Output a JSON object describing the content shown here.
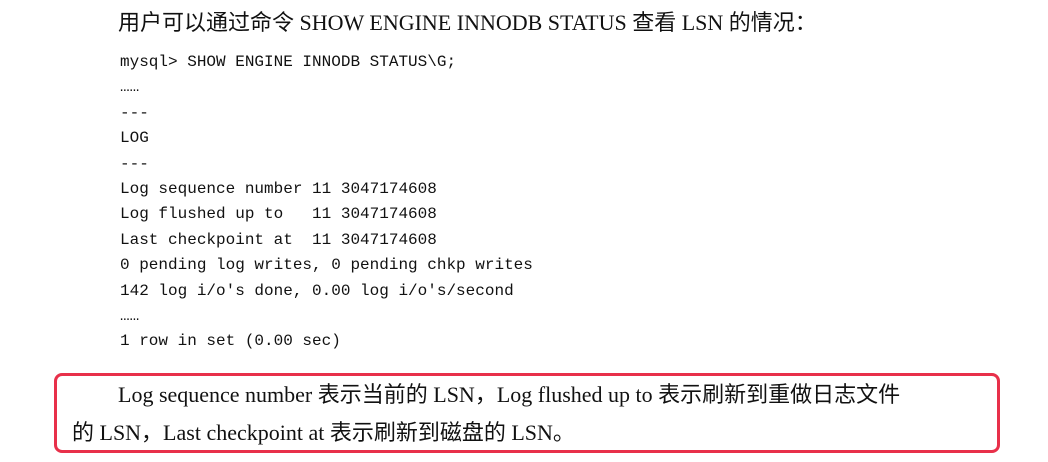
{
  "intro_text": "用户可以通过命令 SHOW ENGINE INNODB STATUS 查看 LSN 的情况：",
  "code_lines": [
    "mysql> SHOW ENGINE INNODB STATUS\\G;",
    "……",
    "---",
    "LOG",
    "---",
    "Log sequence number 11 3047174608",
    "Log flushed up to   11 3047174608",
    "Last checkpoint at  11 3047174608",
    "0 pending log writes, 0 pending chkp writes",
    "142 log i/o's done, 0.00 log i/o's/second",
    "……",
    "1 row in set (0.00 sec)"
  ],
  "highlighted_paragraph": {
    "line1": "Log sequence number 表示当前的 LSN，Log flushed up to 表示刷新到重做日志文件",
    "line2": "的 LSN，Last checkpoint at 表示刷新到磁盘的 LSN。"
  },
  "highlight_color": "#e8304a"
}
